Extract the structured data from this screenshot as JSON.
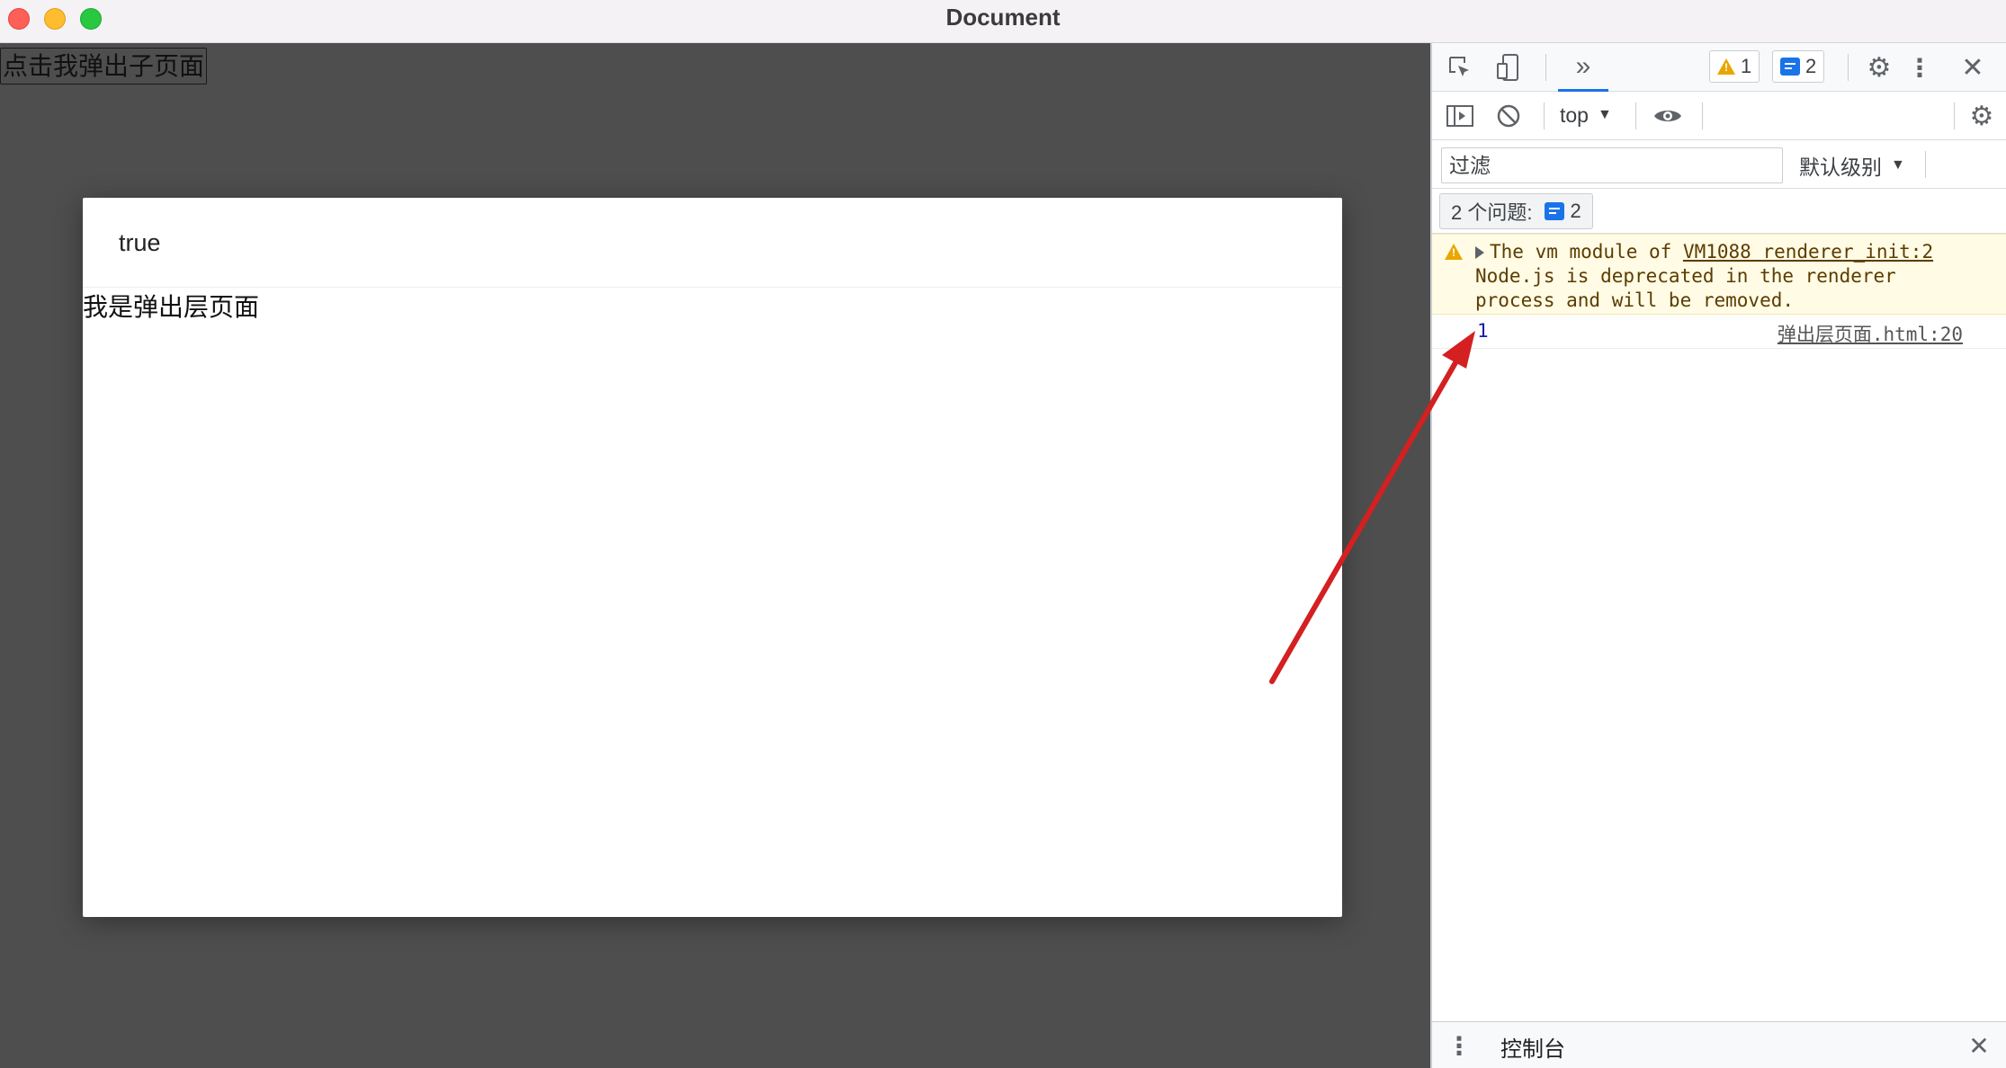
{
  "window": {
    "title": "Document"
  },
  "page": {
    "open_button_label": "点击我弹出子页面",
    "dialog": {
      "header_text": "true",
      "body_text": "我是弹出层页面"
    }
  },
  "devtools": {
    "toolbar": {
      "more_tabs": "»",
      "warning_count": "1",
      "message_count": "2"
    },
    "console_toolbar": {
      "context": "top",
      "filter_placeholder": "过滤",
      "level": "默认级别"
    },
    "issues": {
      "label": "2 个问题:",
      "count": "2"
    },
    "messages": [
      {
        "type": "warning",
        "text_before_link": "The vm module of ",
        "link": "VM1088 renderer_init:2",
        "text_after": "Node.js is deprecated in the renderer process and will be removed."
      },
      {
        "type": "log",
        "value": "1",
        "source": "弹出层页面.html:20"
      }
    ],
    "drawer": {
      "title": "控制台"
    }
  },
  "colors": {
    "accent": "#1a73e8",
    "warning": "#e8a600",
    "arrow": "#d42020"
  }
}
